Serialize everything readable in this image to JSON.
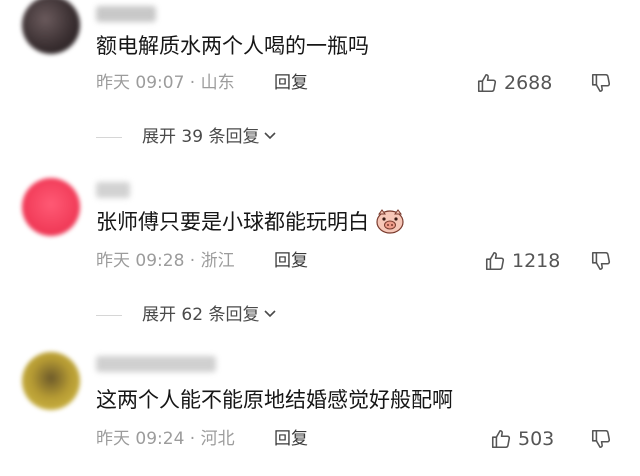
{
  "comments": [
    {
      "text": "额电解质水两个人喝的一瓶吗",
      "meta": "昨天 09:07 · 山东",
      "reply_label": "回复",
      "likes": "2688",
      "expand_label": "展开 39 条回复",
      "avatar_color": "#3b3032"
    },
    {
      "text": "张师傅只要是小球都能玩明白",
      "meta": "昨天 09:28 · 浙江",
      "reply_label": "回复",
      "likes": "1218",
      "expand_label": "展开 62 条回复",
      "avatar_color": "#f23d5a"
    },
    {
      "text": "这两个人能不能原地结婚感觉好般配啊",
      "meta": "昨天 09:24 · 河北",
      "reply_label": "回复",
      "likes": "503",
      "avatar_color": "#c9b23a"
    }
  ],
  "icons": {
    "like": "thumbs-up-icon",
    "dislike": "thumbs-down-icon",
    "expand": "chevron-down-icon",
    "emoji": "pig-face-emoji-icon"
  }
}
